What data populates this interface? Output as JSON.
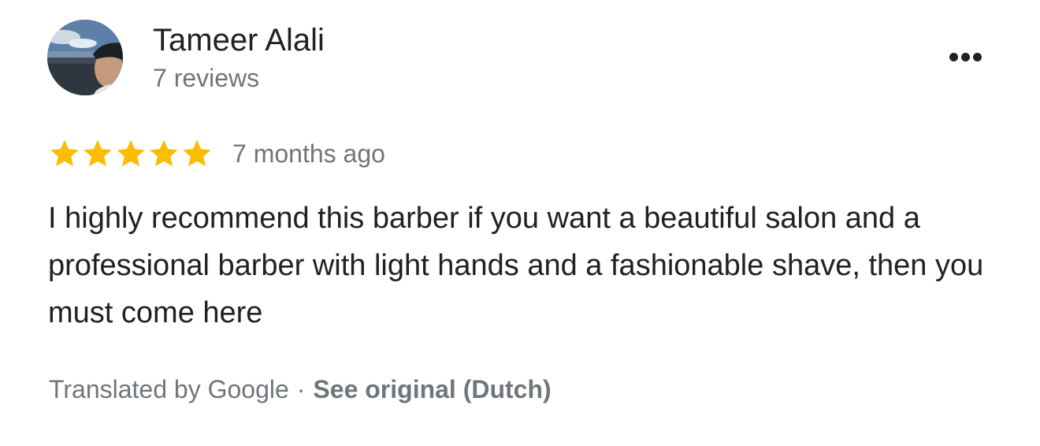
{
  "author": {
    "name": "Tameer Alali",
    "reviews": "7 reviews",
    "avatar_icon": "profile-photo"
  },
  "menu": {
    "icon": "more-horizontal-icon"
  },
  "rating": {
    "stars": 5,
    "max": 5,
    "color": "#FBBC04"
  },
  "review": {
    "time": "7 months ago",
    "text": "I highly recommend this barber if you want a beautiful salon and a professional barber with light hands and a fashionable shave, then you must come here"
  },
  "translation": {
    "label": "Translated by Google",
    "separator": "·",
    "link": "See original (Dutch)"
  },
  "colors": {
    "primary_text": "#202124",
    "secondary_text": "#70757a",
    "background": "#ffffff"
  }
}
